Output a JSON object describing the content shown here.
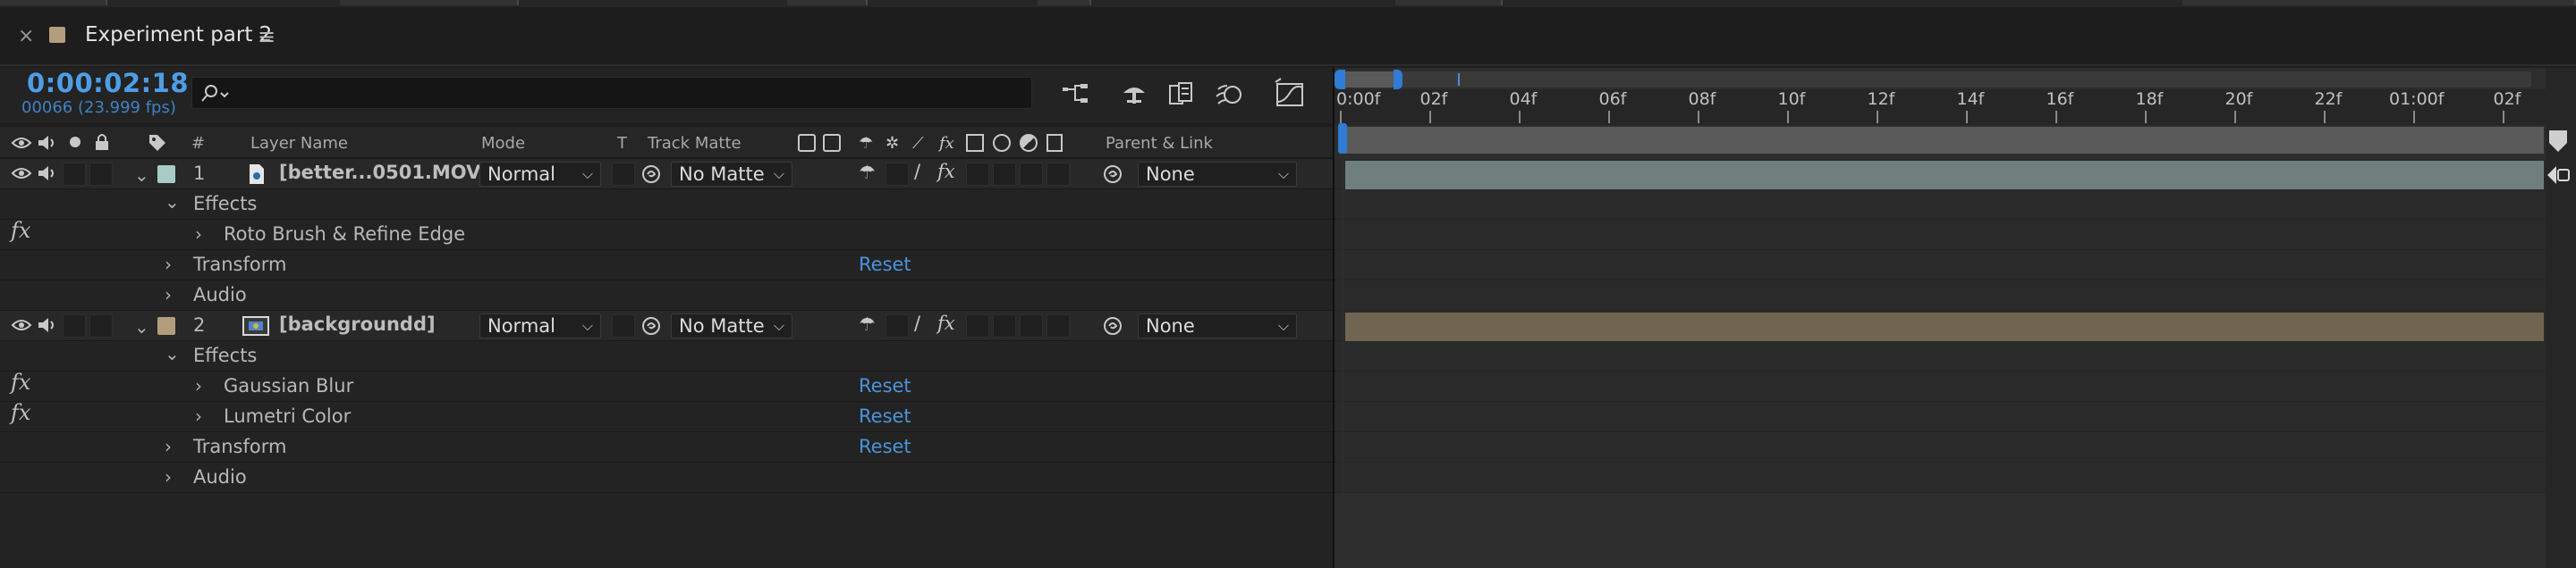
{
  "panel": {
    "title": "Experiment part 2",
    "close_glyph": "×",
    "menu_glyph": "≡",
    "label_color": "#b39d7c"
  },
  "header": {
    "timecode": "0:00:02:18",
    "frame_info": "00066 (23.999 fps)",
    "search_placeholder": ""
  },
  "columns": {
    "hash": "#",
    "layer_name": "Layer Name",
    "mode": "Mode",
    "t": "T",
    "track_matte": "Track Matte",
    "parent_link": "Parent & Link"
  },
  "layers": [
    {
      "number": "1",
      "name": "[better...0501.MOV]",
      "label_color": "#a9cbc6",
      "mode": "Normal",
      "matte": "No Matte",
      "parent": "None",
      "effects_label": "Effects",
      "effects": [
        {
          "name": "Roto Brush & Refine Edge",
          "reset": ""
        }
      ],
      "transform_label": "Transform",
      "transform_reset": "Reset",
      "audio_label": "Audio"
    },
    {
      "number": "2",
      "name": "[backgroundd]",
      "label_color": "#b39d7c",
      "mode": "Normal",
      "matte": "No Matte",
      "parent": "None",
      "effects_label": "Effects",
      "effects": [
        {
          "name": "Gaussian Blur",
          "reset": "Reset"
        },
        {
          "name": "Lumetri Color",
          "reset": "Reset"
        }
      ],
      "transform_label": "Transform",
      "transform_reset": "Reset",
      "audio_label": "Audio"
    }
  ],
  "fx_glyph": "fx",
  "timeline": {
    "ruler_ticks": [
      "0:00f",
      "02f",
      "04f",
      "06f",
      "08f",
      "10f",
      "12f",
      "14f",
      "16f",
      "18f",
      "20f",
      "22f",
      "01:00f",
      "02f"
    ],
    "bar_colors": {
      "layer1": "#6f7f7c",
      "layer2": "#6f6551"
    },
    "accent": "#2f7bd6"
  }
}
